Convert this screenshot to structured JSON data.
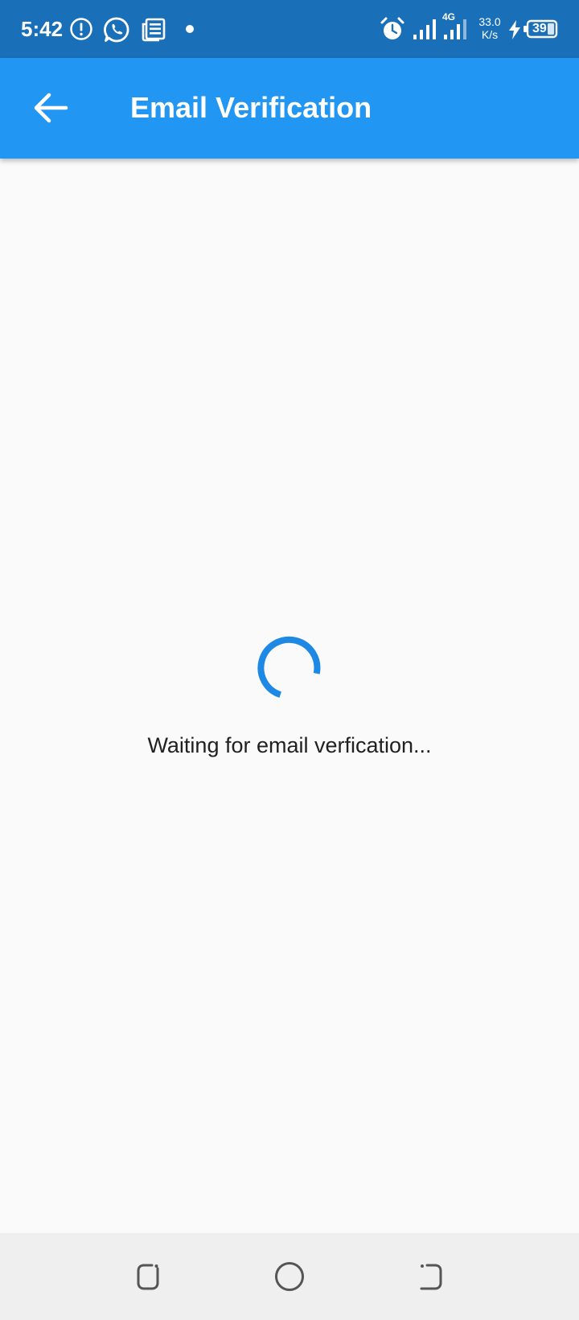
{
  "status_bar": {
    "time": "5:42",
    "network_type": "4G",
    "speed_value": "33.0",
    "speed_unit": "K/s",
    "battery_level": "39",
    "icons": [
      "alert-icon",
      "whatsapp-icon",
      "news-icon",
      "dot-icon",
      "alarm-icon",
      "signal-icon",
      "signal-icon-4g",
      "charging-icon",
      "battery-icon"
    ]
  },
  "app_bar": {
    "title": "Email Verification",
    "back_icon": "arrow-back-icon",
    "background_color": "#2196f3"
  },
  "content": {
    "status_text": "Waiting for email verfication...",
    "spinner_color": "#1e88e5"
  },
  "nav_bar": {
    "icons": [
      "recent-apps-icon",
      "home-icon",
      "back-nav-icon"
    ]
  },
  "colors": {
    "status_bar": "#1a70b8",
    "app_bar": "#2196f3",
    "background": "#fafafa",
    "nav_bar": "#efefef"
  }
}
